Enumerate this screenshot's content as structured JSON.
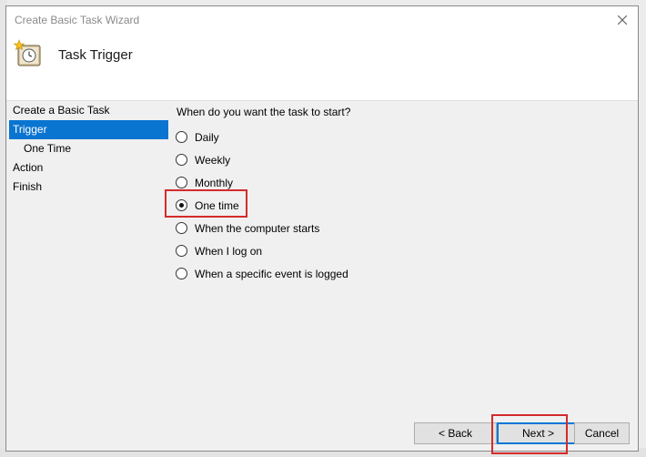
{
  "window": {
    "title": "Create Basic Task Wizard",
    "close_icon": "close-icon"
  },
  "header": {
    "title": "Task Trigger",
    "icon": "task-clock-icon"
  },
  "nav": {
    "items": [
      {
        "label": "Create a Basic Task",
        "selected": false,
        "indent": false
      },
      {
        "label": "Trigger",
        "selected": true,
        "indent": false
      },
      {
        "label": "One Time",
        "selected": false,
        "indent": true
      },
      {
        "label": "Action",
        "selected": false,
        "indent": false
      },
      {
        "label": "Finish",
        "selected": false,
        "indent": false
      }
    ]
  },
  "main": {
    "question": "When do you want the task to start?",
    "options": [
      {
        "label": "Daily",
        "checked": false
      },
      {
        "label": "Weekly",
        "checked": false
      },
      {
        "label": "Monthly",
        "checked": false
      },
      {
        "label": "One time",
        "checked": true
      },
      {
        "label": "When the computer starts",
        "checked": false
      },
      {
        "label": "When I log on",
        "checked": false
      },
      {
        "label": "When a specific event is logged",
        "checked": false
      }
    ]
  },
  "buttons": {
    "back": "< Back",
    "next": "Next >",
    "cancel": "Cancel"
  },
  "colors": {
    "selection": "#0a74d1",
    "highlight": "#d42b2b",
    "focus": "#0078d7"
  }
}
